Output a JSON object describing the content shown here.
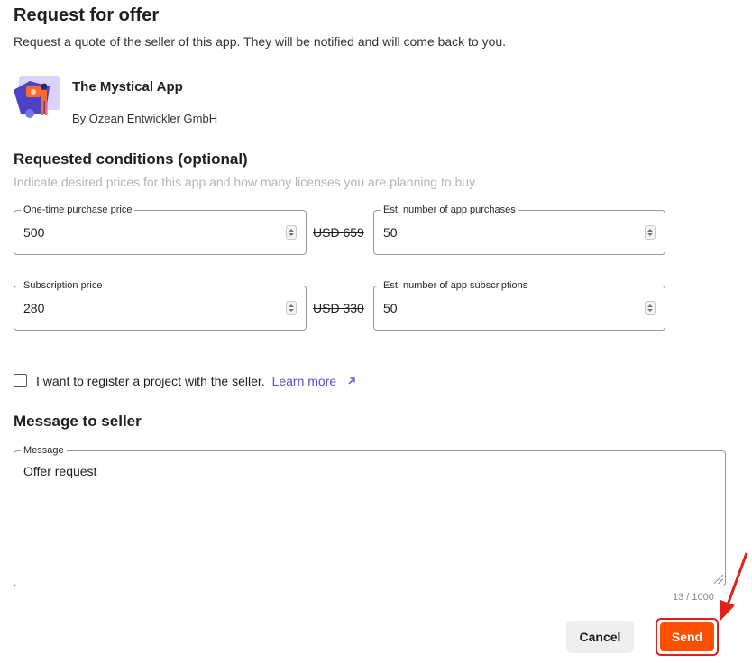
{
  "header": {
    "title": "Request for offer",
    "subtitle": "Request a quote of the seller of this app. They will be notified and will come back to you."
  },
  "app": {
    "name": "The Mystical App",
    "vendor": "By Ozean Entwickler GmbH"
  },
  "conditions": {
    "title": "Requested conditions (optional)",
    "hint": "Indicate desired prices for this app and how many licenses you are planning to buy.",
    "one_time_price": {
      "label": "One-time purchase price",
      "value": "500",
      "list_price": "USD 659"
    },
    "app_purchases": {
      "label": "Est. number of app purchases",
      "value": "50"
    },
    "subscription_price": {
      "label": "Subscription price",
      "value": "280",
      "list_price": "USD 330"
    },
    "app_subscriptions": {
      "label": "Est. number of app subscriptions",
      "value": "50"
    }
  },
  "project": {
    "checkbox_label": "I want to register a project with the seller.",
    "learn_more": "Learn more",
    "checked": false
  },
  "message": {
    "title": "Message to seller",
    "label": "Message",
    "value": "Offer request",
    "counter": "13 / 1000"
  },
  "actions": {
    "cancel_label": "Cancel",
    "send_label": "Send",
    "send_color": "#ff4f00",
    "highlight_color": "#e0201c"
  },
  "icons": {
    "app_icon": "app-illustration-icon",
    "external_link": "external-link-icon",
    "spinner": "number-spinner-icon"
  }
}
